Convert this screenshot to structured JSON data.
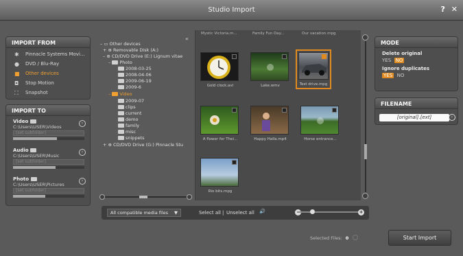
{
  "window": {
    "title": "Studio Import",
    "help_icon": "?",
    "close_icon": "✕"
  },
  "import_from": {
    "heading": "IMPORT FROM",
    "items": [
      {
        "label": "Pinnacle Systems Movi...",
        "icon": "gear-icon",
        "glyph": "✱"
      },
      {
        "label": "DVD / Blu-Ray",
        "icon": "disc-icon",
        "glyph": "●"
      },
      {
        "label": "Other devices",
        "icon": "folder-icon",
        "glyph": "■"
      },
      {
        "label": "Stop Motion",
        "icon": "camera-icon",
        "glyph": "◘"
      },
      {
        "label": "Snapshot",
        "icon": "snapshot-icon",
        "glyph": "⛶"
      }
    ]
  },
  "import_to": {
    "heading": "IMPORT TO",
    "destinations": [
      {
        "label": "Video",
        "path": "C:\\Users\\USER\\Videos",
        "subfolder": "[set subfolder]",
        "fill": 0.62
      },
      {
        "label": "Audio",
        "path": "C:\\Users\\USER\\Music",
        "subfolder": "[set subfolder]",
        "fill": 0.6
      },
      {
        "label": "Photo",
        "path": "C:\\Users\\USER\\Pictures",
        "subfolder": "[set subfolder]",
        "fill": 0.45
      }
    ]
  },
  "tree": {
    "collapse_icon": "«",
    "items": [
      {
        "label": "Other devices",
        "prefix": "– ▭"
      },
      {
        "label": "Removable Disk (A:)",
        "prefix": "+ ⊕"
      },
      {
        "label": "CD/DVD Drive (E:) Lignum vitae",
        "prefix": "– ⊕"
      },
      {
        "label": "Photo",
        "prefix": "–"
      },
      {
        "label": "2008-03-25",
        "prefix": ""
      },
      {
        "label": "2008-04-06",
        "prefix": ""
      },
      {
        "label": "2009-06-19",
        "prefix": ""
      },
      {
        "label": "2009-6",
        "prefix": ""
      },
      {
        "label": "Video",
        "prefix": "–"
      },
      {
        "label": "2009-07",
        "prefix": ""
      },
      {
        "label": "clips",
        "prefix": ""
      },
      {
        "label": "current",
        "prefix": ""
      },
      {
        "label": "demo",
        "prefix": ""
      },
      {
        "label": "family",
        "prefix": ""
      },
      {
        "label": "misc",
        "prefix": ""
      },
      {
        "label": "snippets",
        "prefix": ""
      },
      {
        "label": "CD/DVD Drive (G:) Pinnacle Stu",
        "prefix": "+ ⊕"
      }
    ]
  },
  "grid": {
    "top_captions": [
      "Mystic Victoria.m...",
      "Family Fun Day...",
      "Our vacation.mpg"
    ],
    "thumbs": [
      {
        "caption": "Gold clock.avi",
        "kind": "clock"
      },
      {
        "caption": "Lake.wmv",
        "kind": "lake"
      },
      {
        "caption": "Test drive.mpg",
        "kind": "car"
      },
      {
        "caption": "A flower for Thei...",
        "kind": "flower"
      },
      {
        "caption": "Happy Halla.mp4",
        "kind": "people"
      },
      {
        "caption": "Horse entrance...",
        "kind": "field"
      },
      {
        "caption": "Rio bits.mpg",
        "kind": "sky"
      }
    ]
  },
  "toolbar": {
    "filter": "All compatible media files",
    "filter_arrow": "▼",
    "select_all": "Select all",
    "separator": "|",
    "unselect_all": "Unselect all",
    "speaker": "🔊",
    "zoom_minus": "–",
    "zoom_plus": "+",
    "zoom_level": 0.2
  },
  "mode": {
    "heading": "MODE",
    "delete_original": {
      "label": "Delete original",
      "yes": "YES",
      "no": "NO",
      "value": "NO"
    },
    "ignore_duplicates": {
      "label": "Ignore duplicates",
      "yes": "YES",
      "no": "NO",
      "value": "YES"
    }
  },
  "filename": {
    "heading": "FILENAME",
    "value": "[original].[ext]",
    "arrow": "›"
  },
  "footer": {
    "selected_label": "Selected Files:",
    "selected_count": "0",
    "start_label": "Start Import"
  },
  "colors": {
    "accent": "#e08a20",
    "panel": "#4e4e4e",
    "background": "#5a5a5a"
  }
}
